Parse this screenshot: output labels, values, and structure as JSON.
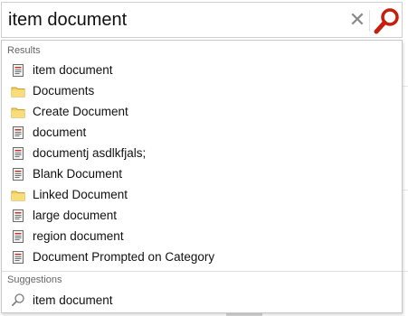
{
  "search": {
    "value": "item document",
    "clear_icon": "close-icon",
    "search_icon": "magnifier-icon",
    "accent_color": "#c81c0c"
  },
  "dropdown": {
    "results_header": "Results",
    "results": [
      {
        "label": "item document",
        "icon": "document-icon"
      },
      {
        "label": "Documents",
        "icon": "folder-icon"
      },
      {
        "label": "Create Document",
        "icon": "folder-icon"
      },
      {
        "label": "document",
        "icon": "document-icon"
      },
      {
        "label": "documentj asdlkfjals;",
        "icon": "document-icon"
      },
      {
        "label": "Blank Document",
        "icon": "document-icon"
      },
      {
        "label": "Linked Document",
        "icon": "folder-icon"
      },
      {
        "label": "large document",
        "icon": "document-icon"
      },
      {
        "label": "region document",
        "icon": "document-icon"
      },
      {
        "label": "Document Prompted on Category",
        "icon": "document-icon"
      }
    ],
    "suggestions_header": "Suggestions",
    "suggestions": [
      {
        "label": "item document",
        "icon": "search-icon"
      }
    ]
  }
}
